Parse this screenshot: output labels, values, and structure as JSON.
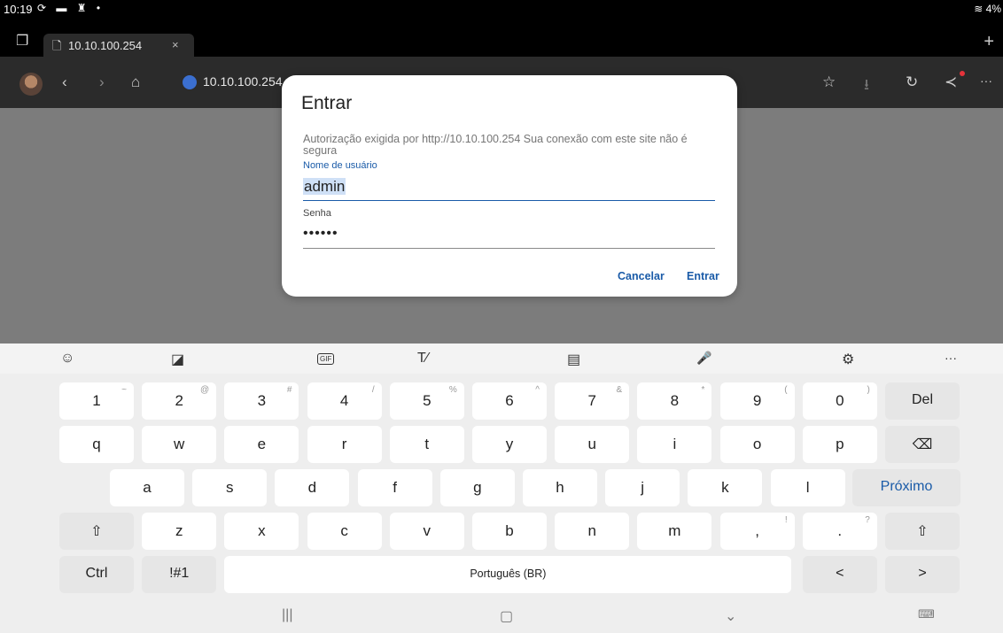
{
  "status": {
    "time": "10:19",
    "icons": "⟳ ▬ ♜ •",
    "right": "≋ 4%"
  },
  "tab": {
    "title": "10.10.100.254",
    "close": "×",
    "page_icon": "🗋"
  },
  "tabstrip": {
    "tabs_icon": "❐",
    "new_tab": "+"
  },
  "toolbar": {
    "url": "10.10.100.254",
    "back": "‹",
    "forward": "›",
    "home": "⌂",
    "favorite": "☆",
    "download": "⭳",
    "refresh": "↻",
    "share": "≺",
    "more": "···"
  },
  "dialog": {
    "title": "Entrar",
    "message": "Autorização exigida por http://10.10.100.254 Sua conexão com este site não é segura",
    "username_label": "Nome de usuário",
    "username_value": "admin",
    "password_label": "Senha",
    "password_value": "••••••",
    "cancel": "Cancelar",
    "submit": "Entrar"
  },
  "kb_toolbar": {
    "emoji": "☺",
    "sticker": "◪",
    "gif": "GIF",
    "handwriting": "T⁄",
    "clipboard": "▤",
    "mic": "🎤",
    "settings": "⚙",
    "more": "···"
  },
  "keyboard": {
    "row1": [
      {
        "k": "1",
        "h": "~"
      },
      {
        "k": "2",
        "h": "@"
      },
      {
        "k": "3",
        "h": "#"
      },
      {
        "k": "4",
        "h": "/"
      },
      {
        "k": "5",
        "h": "%"
      },
      {
        "k": "6",
        "h": "^"
      },
      {
        "k": "7",
        "h": "&"
      },
      {
        "k": "8",
        "h": "*"
      },
      {
        "k": "9",
        "h": "("
      },
      {
        "k": "0",
        "h": ")"
      }
    ],
    "del": "Del",
    "row2": [
      "q",
      "w",
      "e",
      "r",
      "t",
      "y",
      "u",
      "i",
      "o",
      "p"
    ],
    "backspace": "⌫",
    "row3": [
      "a",
      "s",
      "d",
      "f",
      "g",
      "h",
      "j",
      "k",
      "l"
    ],
    "next": "Próximo",
    "shift": "⇧",
    "row4": [
      "z",
      "x",
      "c",
      "v",
      "b",
      "n",
      "m"
    ],
    "comma": {
      "k": ",",
      "h": "!"
    },
    "period": {
      "k": ".",
      "h": "?"
    },
    "ctrl": "Ctrl",
    "symbols": "!#1",
    "space": "Português (BR)",
    "left": "<",
    "right": ">"
  },
  "navbar": {
    "recents": "|||",
    "home": "▢",
    "back": "⌄",
    "keyboard": "⌨"
  }
}
